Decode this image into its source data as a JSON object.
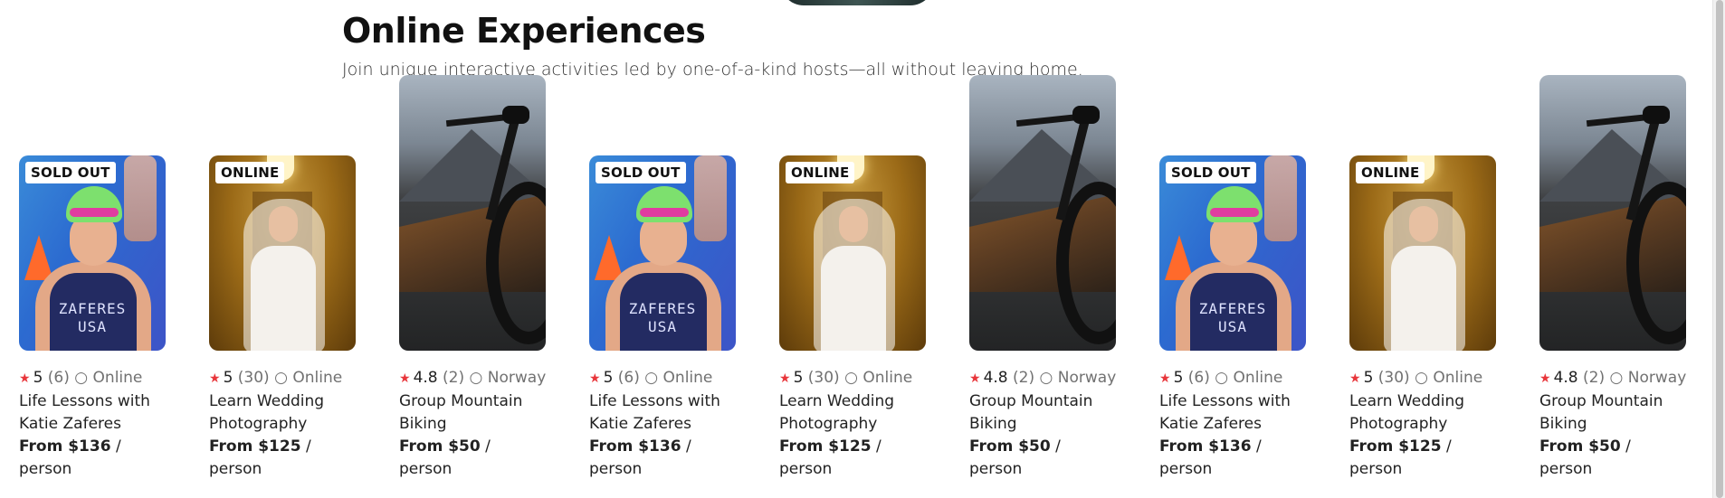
{
  "section": {
    "title": "Online Experiences",
    "subtitle": "Join unique interactive activities led by one-of-a-kind hosts—all without leaving home."
  },
  "colors": {
    "star": "#e8363b",
    "muted_text": "#717171",
    "text": "#222222"
  },
  "cards": [
    {
      "badge": "SOLD OUT",
      "rating": "5",
      "reviews": "(6)",
      "location": "Online",
      "title_line1": "Life Lessons with",
      "title_line2": "Katie Zaferes",
      "price": "From $136",
      "unit": "/ person",
      "image": "swimmer-photo",
      "suit_line1": "ZAFERES",
      "suit_line2": "USA"
    },
    {
      "badge": "ONLINE",
      "rating": "5",
      "reviews": "(30)",
      "location": "Online",
      "title_line1": "Learn Wedding",
      "title_line2": "Photography",
      "price": "From $125",
      "unit": "/ person",
      "image": "bride-photo"
    },
    {
      "badge": "",
      "rating": "4.8",
      "reviews": "(2)",
      "location": "Norway",
      "title_line1": "Group Mountain",
      "title_line2": "Biking",
      "price": "From $50",
      "unit": "/ person",
      "image": "mountain-bike-photo"
    },
    {
      "badge": "SOLD OUT",
      "rating": "5",
      "reviews": "(6)",
      "location": "Online",
      "title_line1": "Life Lessons with",
      "title_line2": "Katie Zaferes",
      "price": "From $136",
      "unit": "/ person",
      "image": "swimmer-photo",
      "suit_line1": "ZAFERES",
      "suit_line2": "USA"
    },
    {
      "badge": "ONLINE",
      "rating": "5",
      "reviews": "(30)",
      "location": "Online",
      "title_line1": "Learn Wedding",
      "title_line2": "Photography",
      "price": "From $125",
      "unit": "/ person",
      "image": "bride-photo"
    },
    {
      "badge": "",
      "rating": "4.8",
      "reviews": "(2)",
      "location": "Norway",
      "title_line1": "Group Mountain",
      "title_line2": "Biking",
      "price": "From $50",
      "unit": "/ person",
      "image": "mountain-bike-photo"
    },
    {
      "badge": "SOLD OUT",
      "rating": "5",
      "reviews": "(6)",
      "location": "Online",
      "title_line1": "Life Lessons with",
      "title_line2": "Katie Zaferes",
      "price": "From $136",
      "unit": "/ person",
      "image": "swimmer-photo",
      "suit_line1": "ZAFERES",
      "suit_line2": "USA"
    },
    {
      "badge": "ONLINE",
      "rating": "5",
      "reviews": "(30)",
      "location": "Online",
      "title_line1": "Learn Wedding",
      "title_line2": "Photography",
      "price": "From $125",
      "unit": "/ person",
      "image": "bride-photo"
    },
    {
      "badge": "",
      "rating": "4.8",
      "reviews": "(2)",
      "location": "Norway",
      "title_line1": "Group Mountain",
      "title_line2": "Biking",
      "price": "From $50",
      "unit": "/ person",
      "image": "mountain-bike-photo"
    }
  ]
}
